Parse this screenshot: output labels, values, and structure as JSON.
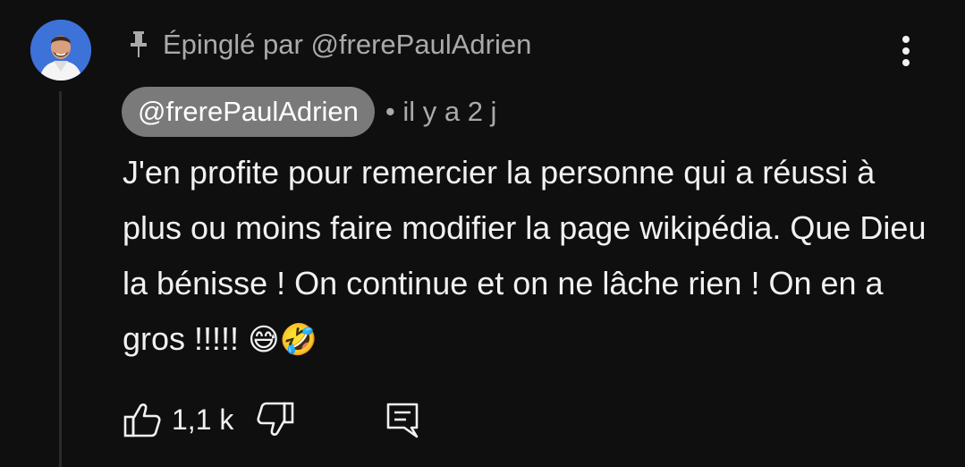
{
  "comment": {
    "pinned_text": "Épinglé par @frerePaulAdrien",
    "author": "@frerePaulAdrien",
    "time": "• il y a 2 j",
    "text": "J'en profite pour remercier la personne qui a réussi à plus ou moins faire modifier la page wikipédia. Que Dieu la bénisse ! On continue et on ne lâche rien ! On en a gros !!!!!",
    "emojis": "😅🤣",
    "likes": "1,1 k"
  },
  "icons": {
    "pin": "pin-icon",
    "more": "more-vert-icon",
    "like": "thumb-up-icon",
    "dislike": "thumb-down-icon",
    "reply": "comment-reply-icon"
  },
  "colors": {
    "background": "#0f0f0f",
    "text": "#f1f1f1",
    "secondary_text": "#aaaaaa",
    "author_chip": "#7a7a7a"
  }
}
